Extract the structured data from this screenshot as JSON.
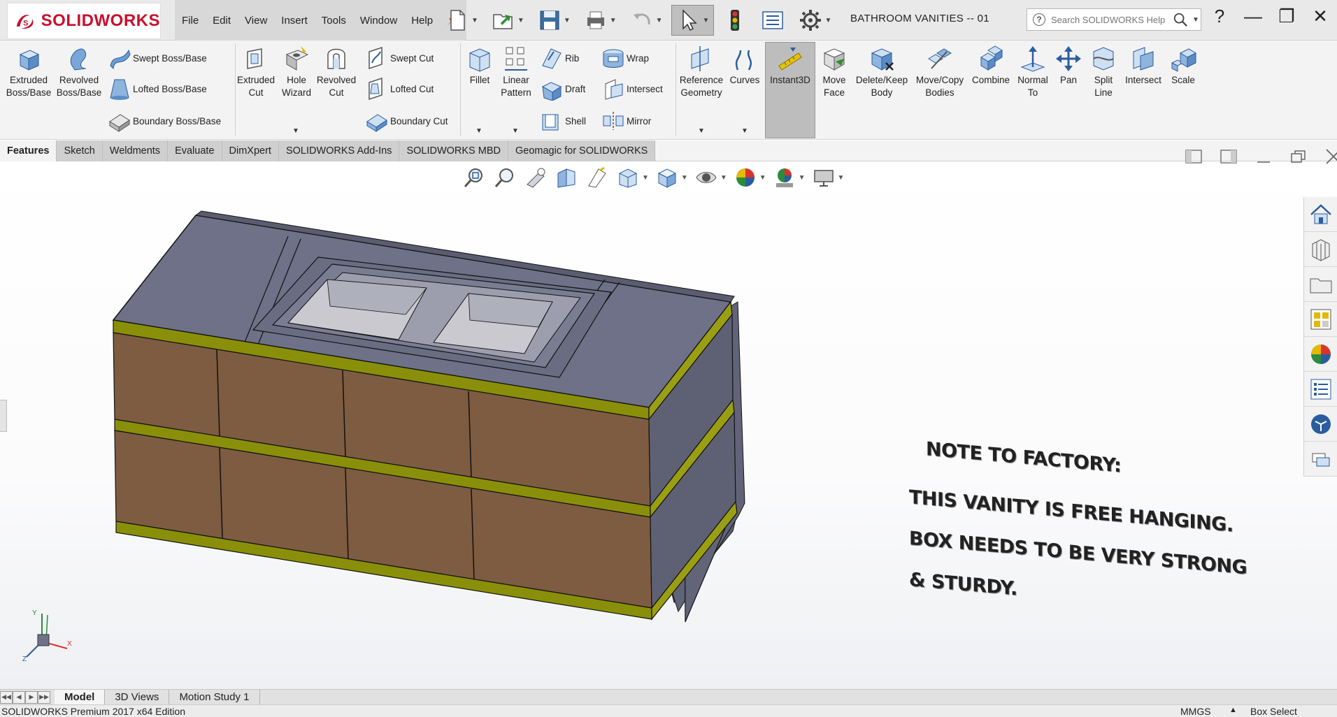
{
  "app": {
    "logo_text": "SOLIDWORKS",
    "document_title": "BATHROOM VANITIES -- 01"
  },
  "menu": [
    "File",
    "Edit",
    "View",
    "Insert",
    "Tools",
    "Window",
    "Help"
  ],
  "help_search": {
    "placeholder": "Search SOLIDWORKS Help"
  },
  "features_toolbar": {
    "extruded_boss": "Extruded\nBoss/Base",
    "revolved_boss": "Revolved\nBoss/Base",
    "swept_boss": "Swept Boss/Base",
    "lofted_boss": "Lofted Boss/Base",
    "boundary_boss": "Boundary Boss/Base",
    "extruded_cut": "Extruded\nCut",
    "hole_wizard": "Hole\nWizard",
    "revolved_cut": "Revolved\nCut",
    "swept_cut": "Swept Cut",
    "lofted_cut": "Lofted Cut",
    "boundary_cut": "Boundary Cut",
    "fillet": "Fillet",
    "linear_pattern": "Linear\nPattern",
    "rib": "Rib",
    "draft": "Draft",
    "shell": "Shell",
    "wrap": "Wrap",
    "intersect_small": "Intersect",
    "mirror": "Mirror",
    "reference_geometry": "Reference\nGeometry",
    "curves": "Curves",
    "instant3d": "Instant3D",
    "move_face": "Move\nFace",
    "delete_keep_body": "Delete/Keep\nBody",
    "move_copy_bodies": "Move/Copy\nBodies",
    "combine": "Combine",
    "normal_to": "Normal\nTo",
    "pan": "Pan",
    "split_line": "Split\nLine",
    "intersect": "Intersect",
    "scale": "Scale"
  },
  "tabs": [
    "Features",
    "Sketch",
    "Weldments",
    "Evaluate",
    "DimXpert",
    "SOLIDWORKS Add-Ins",
    "SOLIDWORKS MBD",
    "Geomagic for SOLIDWORKS"
  ],
  "note": {
    "lines": [
      "NOTE TO FACTORY:",
      "THIS VANITY IS FREE HANGING.",
      "BOX NEEDS  TO  BE VERY STRONG",
      "& STURDY."
    ]
  },
  "triad": {
    "x": "X",
    "y": "Y",
    "z": "Z"
  },
  "bottom_tabs": [
    "Model",
    "3D Views",
    "Motion Study 1"
  ],
  "status": {
    "edition": "SOLIDWORKS Premium 2017 x64 Edition",
    "units": "MMGS",
    "mode": "Box Select"
  },
  "colors": {
    "brand_red": "#c8102e",
    "top_gray": "#6e7187",
    "side_gray": "#5d6073",
    "drawer_brown": "#7e5c41",
    "strip_yellow": "#8a8f0a"
  }
}
